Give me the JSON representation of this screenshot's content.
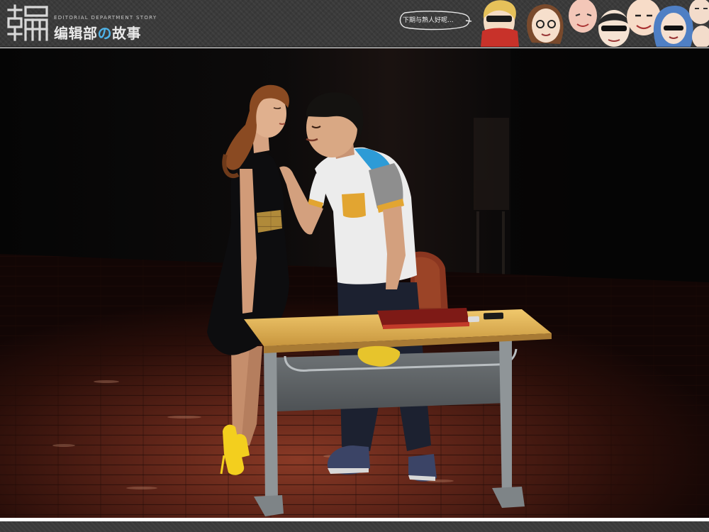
{
  "header": {
    "logo_glyph": "编",
    "subtitle": "EDITORIAL DEPARTMENT STORY",
    "title_part1": "编辑部",
    "title_accent": "の",
    "title_part2": "故事",
    "speech_bubble_text": "下期与熟人好呢..."
  },
  "colors": {
    "banner_background": "#3a3a3a",
    "title_accent": "#4fb3e8",
    "stage_floor": "#5a2418",
    "desk_top": "#e0b45a",
    "desk_frame": "#8f9598",
    "laptop": "#7e1a16",
    "dress": "#0d0d0f",
    "heels": "#f3cf1e",
    "shirt_accent_blue": "#2d9bd6",
    "shirt_pocket_yellow": "#e2a531",
    "shirt_sleeve_gray": "#8e8e8e"
  },
  "icons": [
    "logo-mark-icon",
    "speech-bubble-icon",
    "cartoon-faces-strip-icon"
  ]
}
